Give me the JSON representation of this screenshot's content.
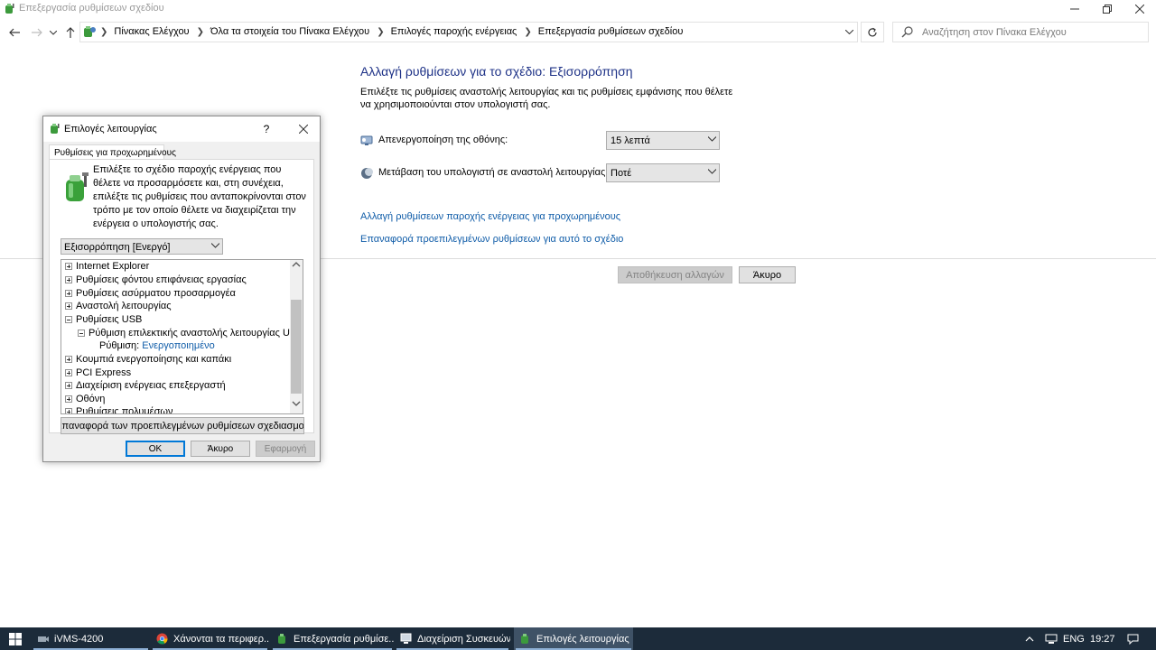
{
  "window": {
    "title": "Επεξεργασία ρυθμίσεων σχεδίου"
  },
  "address": {
    "crumbs": [
      "Πίνακας Ελέγχου",
      "Όλα τα στοιχεία του Πίνακα Ελέγχου",
      "Επιλογές παροχής ενέργειας",
      "Επεξεργασία ρυθμίσεων σχεδίου"
    ]
  },
  "search": {
    "placeholder": "Αναζήτηση στον Πίνακα Ελέγχου"
  },
  "main": {
    "title": "Αλλαγή ρυθμίσεων για το σχέδιο: Εξισορρόπηση",
    "description": "Επιλέξτε τις ρυθμίσεις αναστολής λειτουργίας και τις ρυθμίσεις εμφάνισης που θέλετε να χρησιμοποιούνται στον υπολογιστή σας.",
    "display_off_label": "Απενεργοποίηση της οθόνης:",
    "display_off_value": "15 λεπτά",
    "sleep_label": "Μετάβαση του υπολογιστή σε αναστολή λειτουργίας:",
    "sleep_value": "Ποτέ",
    "link_advanced": "Αλλαγή ρυθμίσεων παροχής ενέργειας για προχωρημένους",
    "link_restore": "Επαναφορά προεπιλεγμένων ρυθμίσεων για αυτό το σχέδιο",
    "save_label": "Αποθήκευση αλλαγών",
    "cancel_label": "Άκυρο"
  },
  "dialog": {
    "title": "Επιλογές λειτουργίας",
    "help": "?",
    "tab": "Ρυθμίσεις για προχωρημένους",
    "description": "Επιλέξτε το σχέδιο παροχής ενέργειας που θέλετε να προσαρμόσετε και, στη συνέχεια, επιλέξτε τις ρυθμίσεις που ανταποκρίνονται στον τρόπο με τον οποίο θέλετε να διαχειρίζεται την ενέργεια ο υπολογιστής σας.",
    "plan": "Εξισορρόπηση [Ενεργό]",
    "tree": {
      "internet_explorer": "Internet Explorer",
      "desktop_background": "Ρυθμίσεις φόντου επιφάνειας εργασίας",
      "wireless_adapter": "Ρυθμίσεις ασύρματου προσαρμογέα",
      "sleep": "Αναστολή λειτουργίας",
      "usb": "Ρυθμίσεις USB",
      "usb_selective": "Ρύθμιση επιλεκτικής αναστολής λειτουργίας USB",
      "setting_label": "Ρύθμιση:",
      "setting_value": "Ενεργοποιημένο",
      "power_buttons": "Κουμπιά ενεργοποίησης και καπάκι",
      "pci_express": "PCI Express",
      "processor": "Διαχείριση ενέργειας επεξεργαστή",
      "display": "Οθόνη",
      "multimedia": "Ρυθμίσεις πολυμέσων"
    },
    "restore_label": "Επαναφορά των προεπιλεγμένων ρυθμίσεων σχεδιασμού",
    "ok_label": "OK",
    "cancel_label": "Άκυρο",
    "apply_label": "Εφαρμογή"
  },
  "taskbar": {
    "tasks": [
      "iVMS-4200",
      "Χάνονται τα περιφερ...",
      "Επεξεργασία ρυθμίσε...",
      "Διαχείριση Συσκευών",
      "Επιλογές λειτουργίας"
    ],
    "language": "ENG",
    "time": "19:27"
  }
}
